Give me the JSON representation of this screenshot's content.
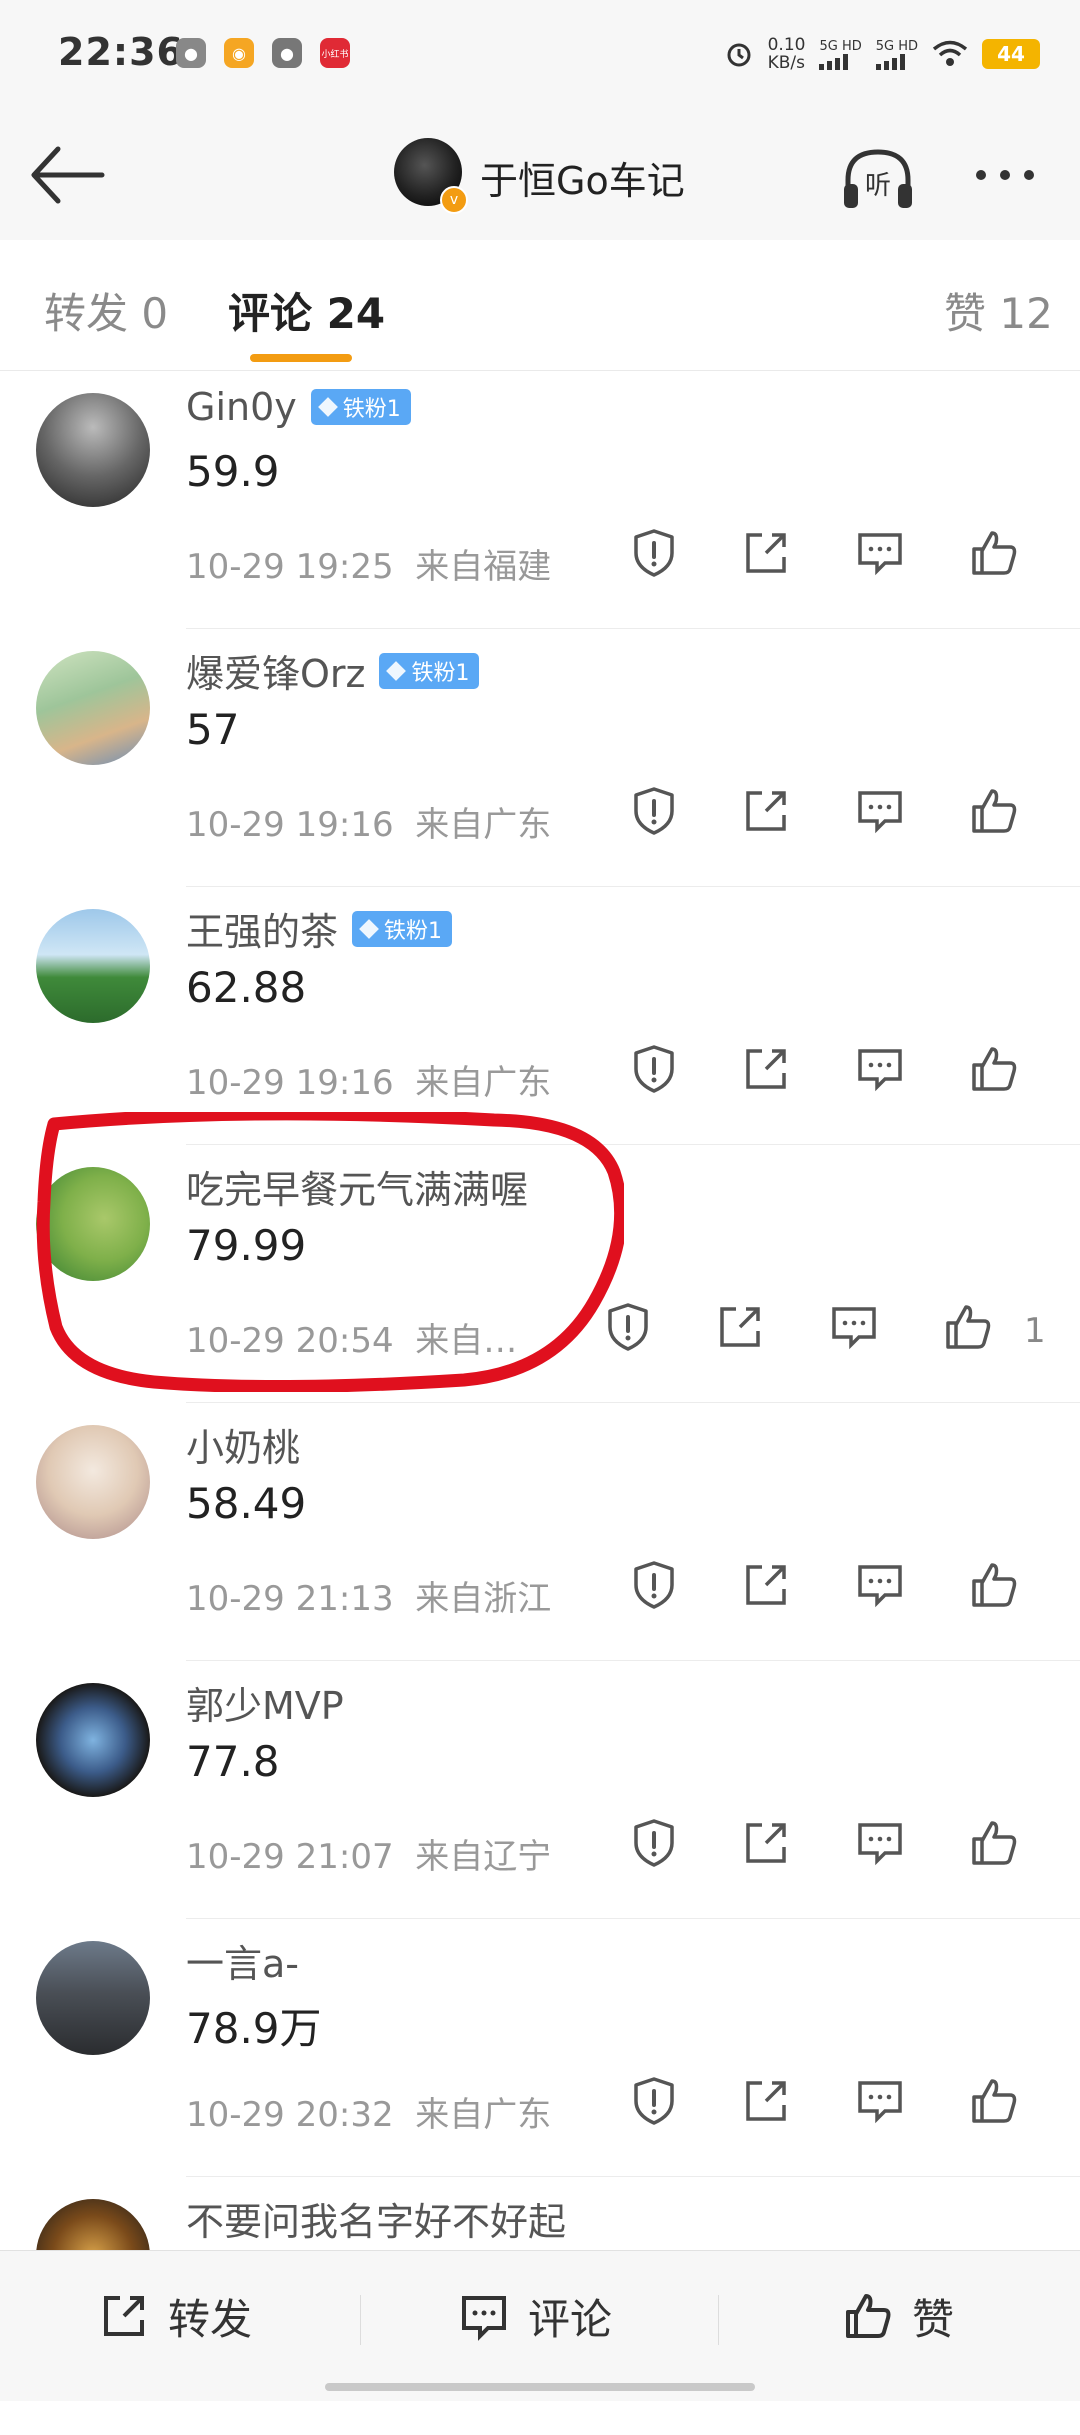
{
  "status_bar": {
    "time": "22:36",
    "net_speed": "0.10",
    "net_unit": "KB/s",
    "sim1": "5G HD",
    "sim2": "5G HD",
    "battery": "44",
    "red_badge": "小红书"
  },
  "header": {
    "title": "于恒Go车记",
    "listen_label": "听"
  },
  "tabs": [
    {
      "label": "转发 0"
    },
    {
      "label": "评论 24"
    },
    {
      "label": "赞 12"
    }
  ],
  "comments": [
    {
      "name": "Gin0y",
      "badge": "铁粉1",
      "text": "59.9",
      "time": "10-29 19:25",
      "location": "来自福建",
      "likes": ""
    },
    {
      "name": "爆爱锋Orz",
      "badge": "铁粉1",
      "text": "57",
      "time": "10-29 19:16",
      "location": "来自广东",
      "likes": ""
    },
    {
      "name": "王强的茶",
      "badge": "铁粉1",
      "text": "62.88",
      "time": "10-29 19:16",
      "location": "来自广东",
      "likes": ""
    },
    {
      "name": "吃完早餐元气满满喔",
      "badge": "",
      "text": "79.99",
      "time": "10-29 20:54",
      "location": "来自…",
      "likes": "1"
    },
    {
      "name": "小奶桃",
      "badge": "",
      "text": "58.49",
      "time": "10-29 21:13",
      "location": "来自浙江",
      "likes": ""
    },
    {
      "name": "郭少MVP",
      "badge": "",
      "text": "77.8",
      "time": "10-29 21:07",
      "location": "来自辽宁",
      "likes": ""
    },
    {
      "name": "一言a-",
      "badge": "",
      "text": "78.9万",
      "time": "10-29 20:32",
      "location": "来自广东",
      "likes": ""
    },
    {
      "name": "不要问我名字好不好起",
      "badge": "",
      "text": "",
      "time": "",
      "location": "",
      "likes": ""
    }
  ],
  "bottom_bar": {
    "repost": "转发",
    "comment": "评论",
    "like": "赞"
  },
  "colors": {
    "accent": "#f39c12",
    "badge": "#5aa8f5",
    "annotation": "#e0101e"
  }
}
